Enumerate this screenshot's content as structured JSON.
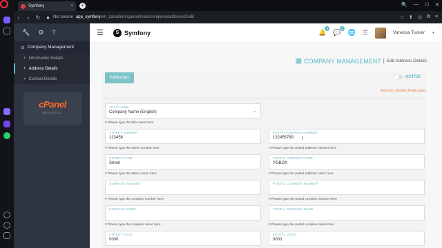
{
  "browser": {
    "tab_title": "Symfony",
    "tab_close": "×",
    "new_tab": "+",
    "not_secure": "Not secure",
    "url_host": "app_symfony",
    "url_path": "/en_za/admin/cpanel/main/company/address/2/edit",
    "win_controls": [
      "🔍",
      "—",
      "☐",
      "✕"
    ],
    "toolbar_icons": [
      "☆",
      "⬆",
      "◎",
      "⧉",
      "≡"
    ]
  },
  "sidebar": {
    "tool_icons": [
      "🔧",
      "⚙",
      "?"
    ],
    "items": [
      {
        "label": "Company Management",
        "icon": "⊙"
      },
      {
        "label": "Information Details",
        "icon": "+"
      },
      {
        "label": "Address Details",
        "icon": "+"
      },
      {
        "label": "Contact Details",
        "icon": "+"
      }
    ],
    "cpanel_logo": "cPanel",
    "cpanel_version": "BETA v0.0.0.1"
  },
  "header": {
    "brand_letter": "S",
    "brand_name": "Symfony",
    "notif_count_1": "3",
    "notif_count_2": "2",
    "user_name": "Vanessa Tucker"
  },
  "page": {
    "title": "COMPANY MANAGEMENT",
    "separator": "|",
    "subtitle": "Edit Address Details",
    "tab_label": "Particulars",
    "status_label": "ACTIVE",
    "section_label": "Address Details Particulars"
  },
  "form": {
    "title_name": {
      "label": "TITLE NAME",
      "value": "Company Name (English)",
      "help": "# Please type the title name here"
    },
    "street_number": {
      "label": "STREET NUMBER",
      "value": "123456",
      "help": "# Please type the street number here"
    },
    "postal_address_number": {
      "label": "POSTAL ADDRESS NUMBER",
      "value": "132456789",
      "help": "# Please type the postal address number here"
    },
    "street_name": {
      "label": "STREET NAME",
      "value": "Street",
      "help": "# Please type the street name here"
    },
    "postal_address_name": {
      "label": "POSTAL ADDRESS NAME",
      "value": "POBOX",
      "help": "# Please type the postal address name here"
    },
    "complex_number": {
      "label": "COMPLEX NUMBER",
      "value": "",
      "help": "# Please type the complex number here"
    },
    "postal_complex_number": {
      "label": "POSTAL COMPLEX NUMBER",
      "value": "",
      "help": "# Please type the postal complex number here"
    },
    "complex_name": {
      "label": "COMPLEX NAME",
      "value": "",
      "help": "# Please type the complex name here"
    },
    "postal_complex_name": {
      "label": "POSTAL COMPLEX NAME",
      "value": "",
      "help": "# Please type the postal complex name here"
    },
    "street_code": {
      "label": "STREET CODE",
      "value": "0000"
    },
    "postal_code": {
      "label": "POSTAL CODE",
      "value": "0000"
    }
  },
  "colors": {
    "accent": "#5ab8c2",
    "sidebar": "#2d3340",
    "orange": "#e8844a"
  }
}
